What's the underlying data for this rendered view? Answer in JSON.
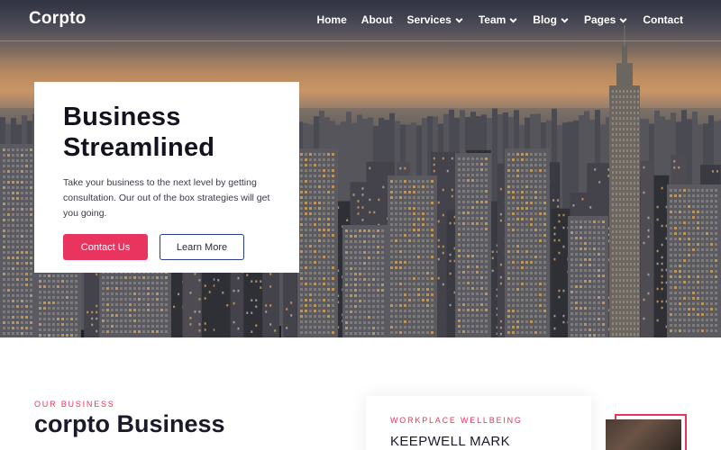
{
  "brand": {
    "name": "Corpto"
  },
  "nav": {
    "items": [
      {
        "label": "Home",
        "has_dropdown": false
      },
      {
        "label": "About",
        "has_dropdown": false
      },
      {
        "label": "Services",
        "has_dropdown": true
      },
      {
        "label": "Team",
        "has_dropdown": true
      },
      {
        "label": "Blog",
        "has_dropdown": true
      },
      {
        "label": "Pages",
        "has_dropdown": true
      },
      {
        "label": "Contact",
        "has_dropdown": false
      }
    ]
  },
  "hero": {
    "title_line1": "Business",
    "title_line2": "Streamlined",
    "text": "Take your business to the next level by getting consultation. Our out of the box strategies will get you going.",
    "primary_button": "Contact Us",
    "secondary_button": "Learn More",
    "background": "city-skyline-sunset-photo"
  },
  "business": {
    "eyebrow": "OUR BUSINESS",
    "title": "corpto Business"
  },
  "wellbeing": {
    "eyebrow": "WORKPLACE WELLBEING",
    "title": "KEEPWELL MARK"
  },
  "colors": {
    "accent": "#e8345f",
    "outline_button_border": "#2b3a8f",
    "heading": "#13131f"
  }
}
